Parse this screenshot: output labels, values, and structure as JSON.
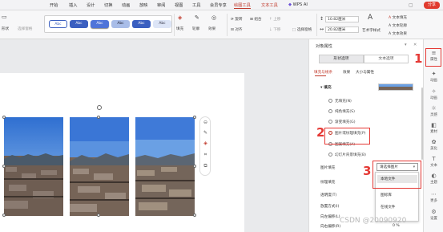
{
  "menubar": {
    "items": [
      "开始",
      "插入",
      "设计",
      "切换",
      "动画",
      "放映",
      "审阅",
      "视图",
      "工具",
      "会员专享",
      "绘图工具",
      "文本工具"
    ],
    "active": "绘图工具",
    "wps_ai": "WPS AI",
    "share": "分享"
  },
  "toolbar": {
    "left": [
      "形状",
      "选择窗格"
    ],
    "shape_styles": [
      "Abc",
      "Abc",
      "Abc",
      "Abc",
      "Abc",
      "Abc"
    ],
    "fill": "填充",
    "outline": "轮廓",
    "effect": "效果",
    "rotate": "旋转",
    "align": "对齐",
    "group": "组合",
    "move_up": "上移",
    "move_down": "下移",
    "selection": "选择窗格",
    "height": "10.82厘米",
    "width": "20.82厘米",
    "art_text": "艺术字样式",
    "text_fill": "文本填充",
    "text_outline": "文本轮廓",
    "text_effect": "文本效果"
  },
  "panel": {
    "title": "对象属性",
    "tab_shape": "形状选项",
    "tab_text": "文本选项",
    "subtabs": [
      "填充与线条",
      "效果",
      "大小与属性"
    ],
    "fill_section": "填充",
    "fill_options": [
      "无填充(N)",
      "纯色填充(S)",
      "渐变填充(G)",
      "图片或纹理填充(P)",
      "图案填充(A)",
      "幻灯片背景填充(B)"
    ],
    "selected_fill": "图片或纹理填充(P)",
    "picture_fill_label": "图片填充",
    "picture_fill_value": "请选择图片",
    "texture_fill_label": "纹理填充",
    "transparency_label": "透明度(T)",
    "tile_label": "放置方式(I)",
    "offset_left": "向左偏移(L)",
    "offset_right": "向右偏移(R)",
    "offset_value": "0 %"
  },
  "dropdown": {
    "items": [
      "本地文件",
      "图标库",
      "在线文件"
    ]
  },
  "sidebar": {
    "items": [
      "属性",
      "动画",
      "动画",
      "灵感",
      "素材",
      "美化",
      "文本",
      "主题",
      "更多",
      "设置"
    ]
  },
  "annotations": {
    "labels": [
      "1",
      "2",
      "3"
    ],
    "color": "#e53935"
  },
  "watermark": "CSDN @20090920"
}
